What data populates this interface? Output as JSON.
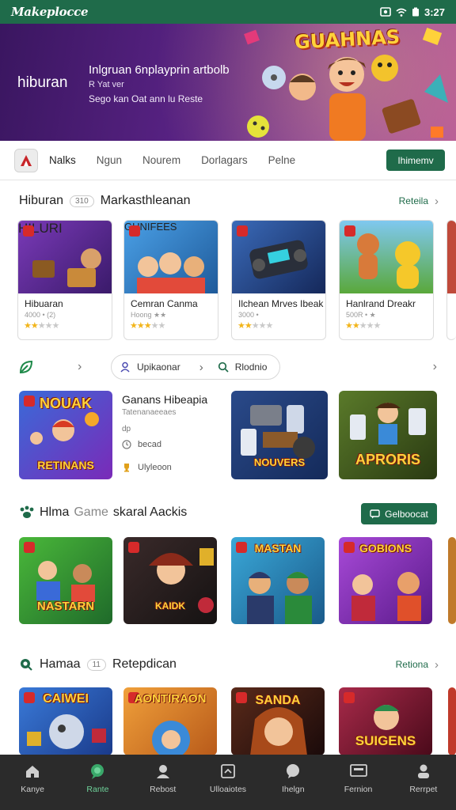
{
  "status_bar": {
    "brand": "Makeplocce",
    "time": "3:27"
  },
  "hero": {
    "title": "hiburan",
    "line1": "Inlgruan 6nplayprin artbolb",
    "line2": "R Yat ver",
    "line3": "Sego kan Oat ann lu Reste",
    "logo_text": "GUAHNAS"
  },
  "tabs": {
    "items": [
      "Nalks",
      "Ngun",
      "Nourem",
      "Dorlagars",
      "Pelne"
    ],
    "button": "Ihimemv"
  },
  "section1": {
    "title": "Hiburan",
    "chip": "310",
    "subtitle": "Markasthleanan",
    "link": "Reteila",
    "cards": [
      {
        "name": "Hibuaran",
        "meta": "4000 • (2)",
        "rating": 2,
        "thumb_text": "HILURI",
        "bg": "#5a2a8a"
      },
      {
        "name": "Cemran Canma",
        "meta": "Hoong ★★",
        "rating": 3,
        "thumb_text": "GUNIFEES",
        "bg": "#3e8fd6"
      },
      {
        "name": "Ilchean Mrves Ibeak",
        "meta": "3000 •",
        "rating": 2,
        "thumb_text": "",
        "bg": "#25407a"
      },
      {
        "name": "Hanlrand Dreakr",
        "meta": "500R • ★",
        "rating": 2,
        "thumb_text": "",
        "bg": "#6fb9e6"
      }
    ]
  },
  "filters": {
    "item1": "Upikaonar",
    "item2": "Rlodnio"
  },
  "featured": {
    "tile_text": "NOUAK",
    "tile_text2": "RETINANS",
    "title": "Ganans Hibeapia",
    "sub": "Tatenanaeeaes",
    "meta1": "dp",
    "meta2": "becad",
    "meta3": "Ulyleoon",
    "tiles": [
      {
        "text": "NOUVERS",
        "bg": "#26467c"
      },
      {
        "text": "APRORIS",
        "bg": "#3b5a1e"
      }
    ]
  },
  "section2": {
    "title": "Hlma",
    "mid": "Game",
    "subtitle": "skaral Aackis",
    "button": "Gelboocat",
    "tiles": [
      {
        "text": "NASTARN",
        "bg": "#3f9a3a"
      },
      {
        "text": "KAIDK",
        "bg": "#2a2a2a"
      },
      {
        "text": "MASTAN",
        "bg": "#2f8fb8"
      },
      {
        "text": "GOBIONS",
        "bg": "#8a3fb8"
      }
    ]
  },
  "section3": {
    "title": "Hamaa",
    "chip": "11",
    "subtitle": "Retepdican",
    "link": "Retiona",
    "tiles": [
      {
        "text": "CAIWEI",
        "bg": "#2f7fc0"
      },
      {
        "text": "AONTIRAON",
        "bg": "#e08a2a"
      },
      {
        "text": "SANDA",
        "bg": "#3a1a1a"
      },
      {
        "text": "SUIGENS",
        "bg": "#7a1f3a"
      }
    ]
  },
  "bottom_nav": {
    "items": [
      {
        "label": "Kanye",
        "icon": "home-icon"
      },
      {
        "label": "Rante",
        "icon": "chat-icon"
      },
      {
        "label": "Rebost",
        "icon": "user-icon"
      },
      {
        "label": "Ulloaiotes",
        "icon": "gallery-icon"
      },
      {
        "label": "Ihelgn",
        "icon": "message-icon"
      },
      {
        "label": "Fernion",
        "icon": "screen-icon"
      },
      {
        "label": "Rerrpet",
        "icon": "profile-icon"
      }
    ]
  },
  "colors": {
    "brand_green": "#1f6b4a",
    "active_nav": "#6fd39b",
    "star": "#f2b51b"
  }
}
